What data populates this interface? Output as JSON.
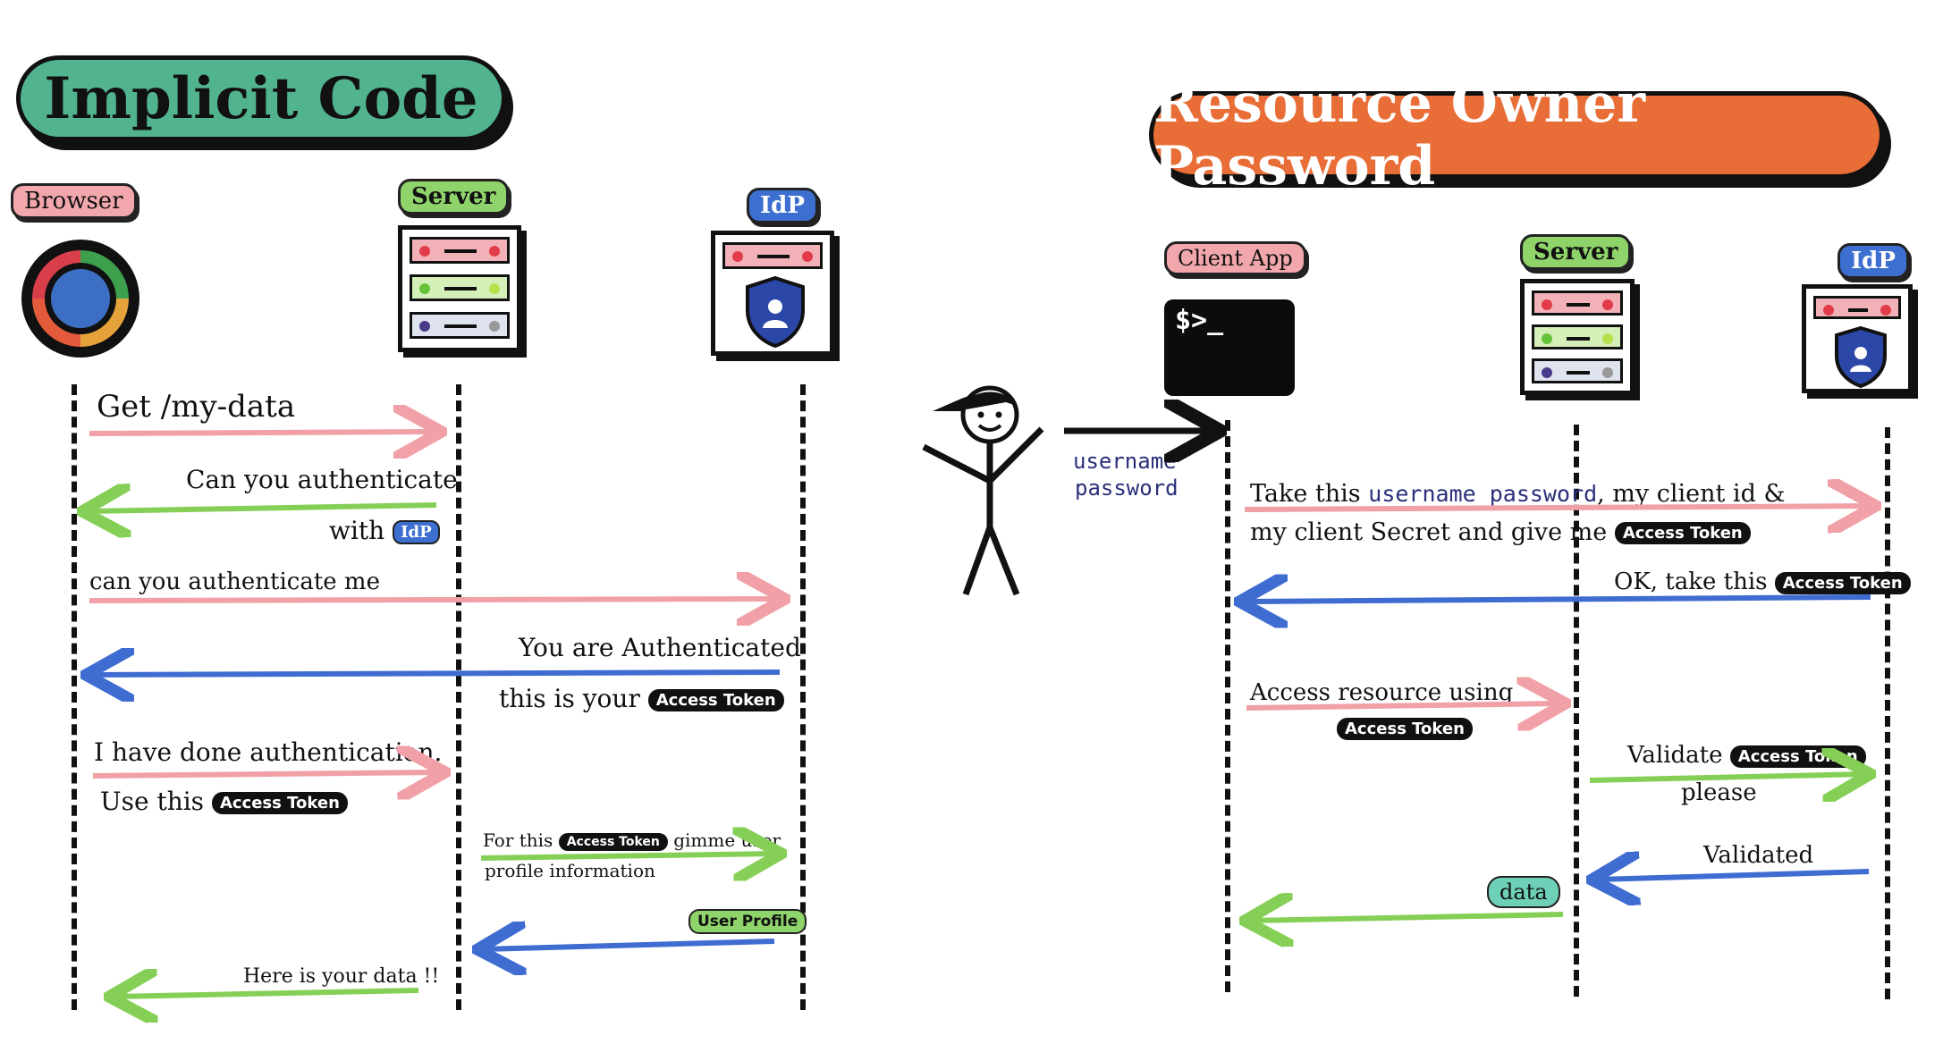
{
  "implicit": {
    "title": "Implicit Code",
    "actors": {
      "browser": "Browser",
      "server": "Server",
      "idp": "IdP"
    },
    "messages": {
      "m1": "Get /my-data",
      "m2_line1": "Can you authenticate",
      "m2_line2": "with",
      "m2_badge": "IdP",
      "m3": "can you authenticate me",
      "m4_line1": "You are Authenticated",
      "m4_line2": "this is your",
      "m5_line1": "I have done authentication.",
      "m5_line2": "Use this",
      "m6_line1": "For this",
      "m6_line1b": "gimme user",
      "m6_line2": "profile information",
      "m7_badge": "User Profile",
      "m8": "Here is your data !!"
    }
  },
  "ropc": {
    "title": "Resource Owner Password",
    "actors": {
      "client": "Client App",
      "server": "Server",
      "idp": "IdP"
    },
    "terminal_prompt": "$>_",
    "user_credentials": {
      "line1": "username",
      "line2": "password"
    },
    "messages": {
      "m1_a": "Take this",
      "m1_b": "username password",
      "m1_c": ", my client id &",
      "m1_line2": "my client Secret and give me",
      "m2": "OK, take this",
      "m3_line1": "Access resource using",
      "m4_line1": "Validate",
      "m4_line2": "please",
      "m5": "Validated",
      "m6_badge": "data"
    }
  },
  "token_label": "Access Token",
  "colors": {
    "implicit_title_bg": "#52b38f",
    "ropc_title_bg": "#e86d36",
    "arrow_pink": "#f0a0a6",
    "arrow_green": "#86cf57",
    "arrow_blue": "#3f6cd1"
  }
}
